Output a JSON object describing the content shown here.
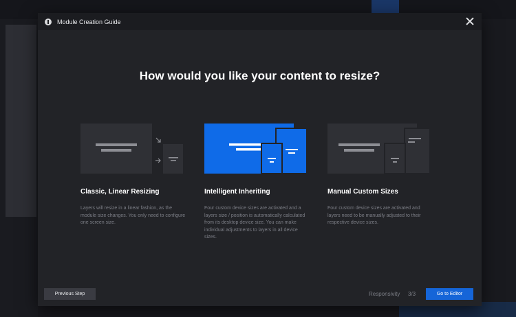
{
  "modal": {
    "title": "Module Creation Guide",
    "heading": "How would you like your content to resize?",
    "options": [
      {
        "title": "Classic, Linear Resizing",
        "description": "Layers will resize in a linear fashion, as the module size changes. You only need to configure one screen size."
      },
      {
        "title": "Intelligent Inheriting",
        "description": "Four custom device sizes are activated and a layers size / position is automatically calculated from its desktop device size. You can make individual adjustments to layers in all device sizes."
      },
      {
        "title": "Manual Custom Sizes",
        "description": "Four custom device sizes are activated and layers need to be manually adjusted to their respective device sizes."
      }
    ],
    "footer": {
      "previous_label": "Previous Step",
      "responsivity_label": "Responsivity",
      "step": "3/3",
      "editor_label": "Go to Editor"
    }
  },
  "colors": {
    "modal_bg": "#222327",
    "accent": "#1565d8",
    "illustration_dark": "#2f3035",
    "illustration_blue": "#0f6be8",
    "muted_text": "#7c7e86"
  },
  "icons": {
    "header": "info-icon",
    "close": "close-icon"
  }
}
